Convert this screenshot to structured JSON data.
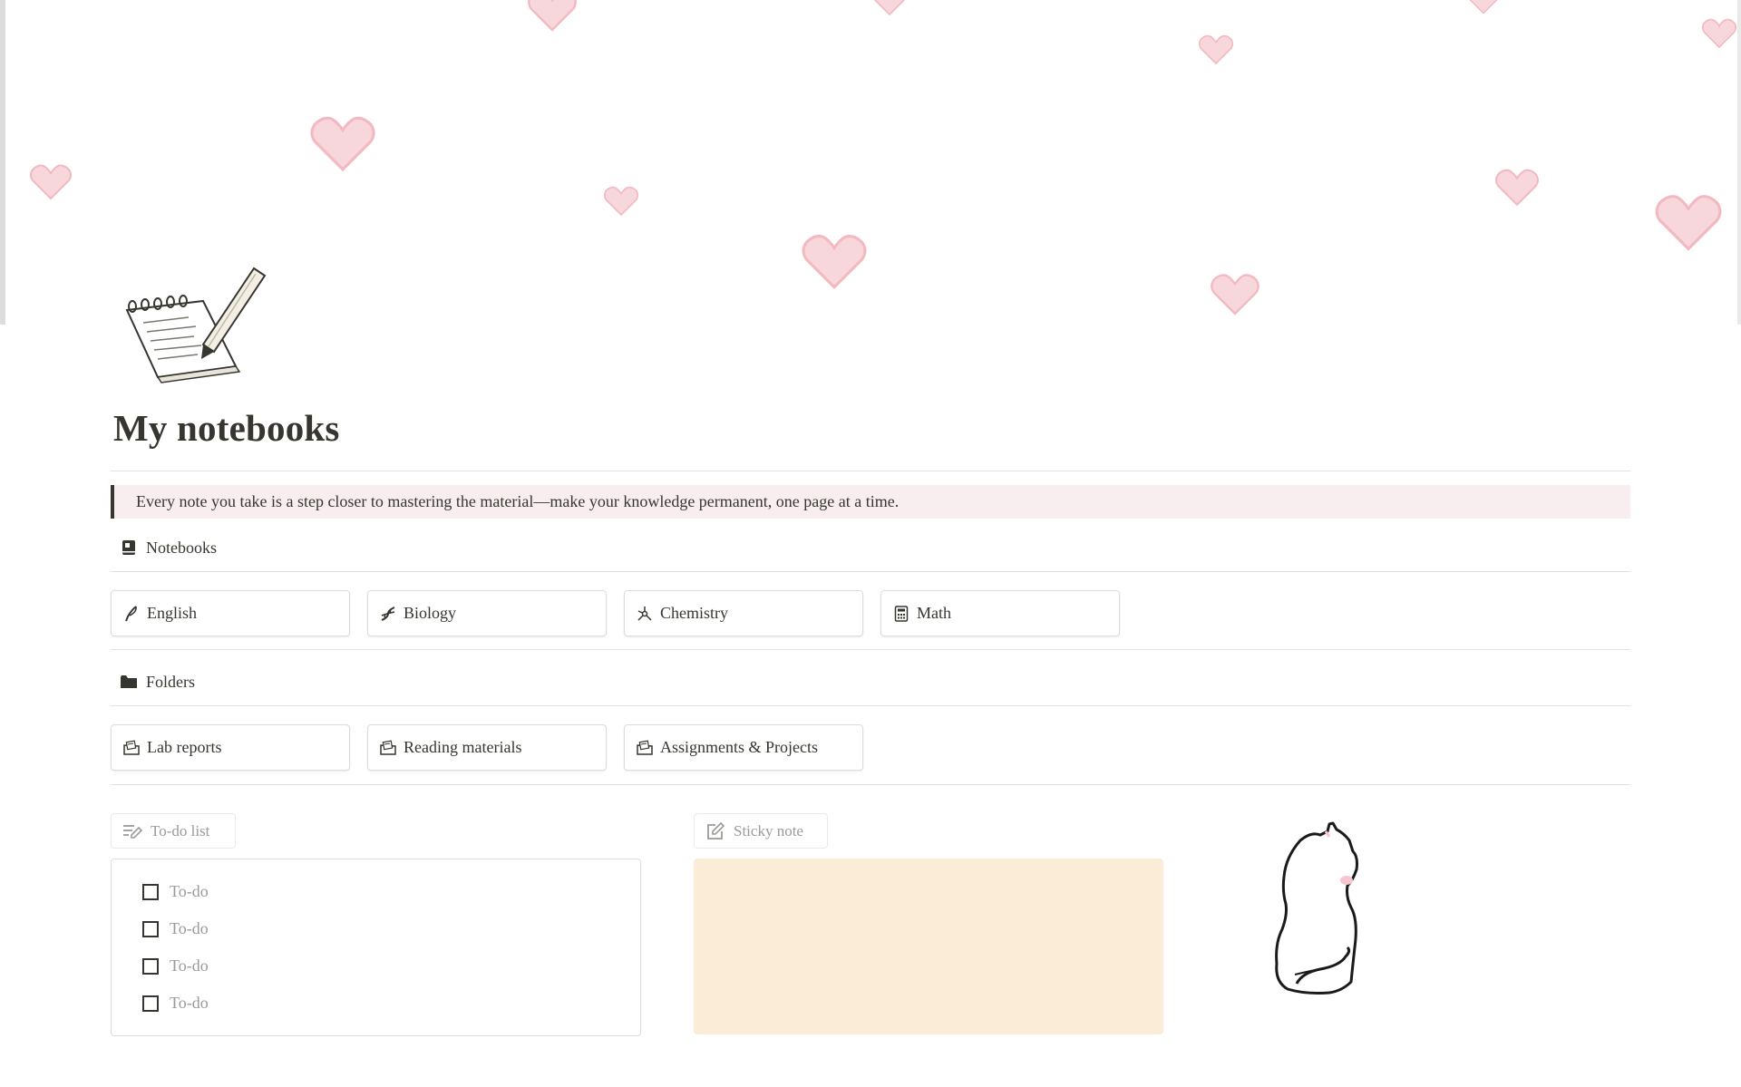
{
  "page": {
    "title": "My notebooks",
    "quote": "Every note you take is a step closer to mastering the material—make your knowledge permanent, one page at a time.",
    "icon": "notepad-pencil-icon"
  },
  "colors": {
    "heart": "#f8d7dc",
    "heart_outline": "#f2b9c1",
    "quote_bg": "#f8eef0",
    "sticky_bg": "#fbecd8",
    "text": "#37352f",
    "muted": "#9b9a97"
  },
  "sections": {
    "notebooks": {
      "heading": "Notebooks",
      "icon": "notebook-icon",
      "items": [
        {
          "label": "English",
          "icon": "quill-icon"
        },
        {
          "label": "Biology",
          "icon": "dna-icon"
        },
        {
          "label": "Chemistry",
          "icon": "molecule-icon"
        },
        {
          "label": "Math",
          "icon": "calculator-icon"
        }
      ]
    },
    "folders": {
      "heading": "Folders",
      "icon": "folder-icon",
      "items": [
        {
          "label": "Lab reports",
          "icon": "folder-doc-icon"
        },
        {
          "label": "Reading materials",
          "icon": "folder-doc-icon"
        },
        {
          "label": "Assignments & Projects",
          "icon": "folder-doc-icon"
        }
      ]
    }
  },
  "todo": {
    "label": "To-do list",
    "icon": "list-edit-icon",
    "items": [
      {
        "text": "To-do",
        "checked": false
      },
      {
        "text": "To-do",
        "checked": false
      },
      {
        "text": "To-do",
        "checked": false
      },
      {
        "text": "To-do",
        "checked": false
      }
    ]
  },
  "sticky": {
    "label": "Sticky note",
    "icon": "note-edit-icon"
  }
}
